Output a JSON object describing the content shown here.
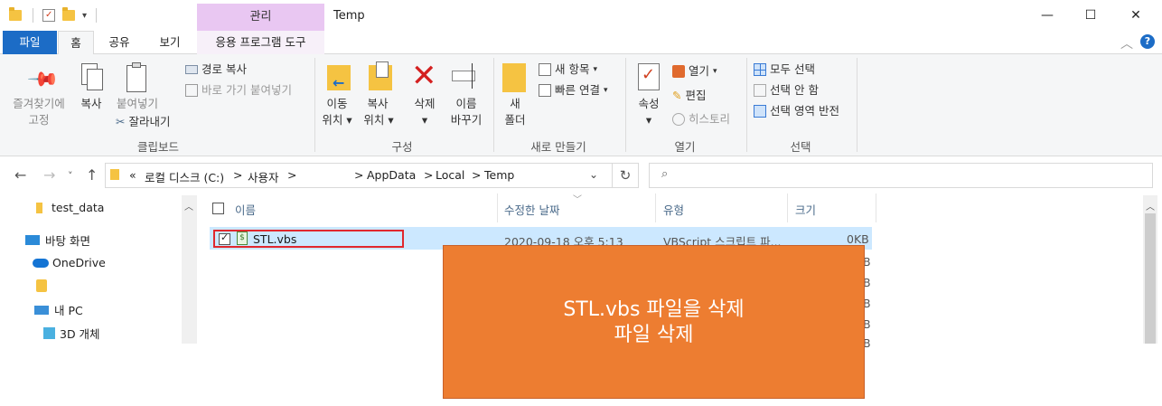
{
  "window": {
    "title": "Temp",
    "context_tab": "관리",
    "controls": {
      "minimize": "—",
      "maximize": "☐",
      "close": "✕"
    }
  },
  "tabs": {
    "file": "파일",
    "home": "홈",
    "share": "공유",
    "view": "보기",
    "app_tools": "응용 프로그램 도구"
  },
  "ribbon": {
    "clipboard": {
      "pin_line1": "즐겨찾기에",
      "pin_line2": "고정",
      "copy": "복사",
      "paste": "붙여넣기",
      "copy_path": "경로 복사",
      "paste_shortcut": "바로 가기 붙여넣기",
      "cut": "잘라내기",
      "label": "클립보드"
    },
    "organize": {
      "move_line1": "이동",
      "move_line2": "위치",
      "copy_line1": "복사",
      "copy_line2": "위치",
      "delete": "삭제",
      "rename_line1": "이름",
      "rename_line2": "바꾸기",
      "label": "구성"
    },
    "new": {
      "folder_line1": "새",
      "folder_line2": "폴더",
      "new_item": "새 항목",
      "easy_access": "빠른 연결",
      "label": "새로 만들기"
    },
    "open": {
      "properties": "속성",
      "open": "열기",
      "edit": "편집",
      "history": "히스토리",
      "label": "열기"
    },
    "select": {
      "select_all": "모두 선택",
      "select_none": "선택 안 함",
      "invert": "선택 영역 반전",
      "label": "선택"
    }
  },
  "address": {
    "prefix": "«",
    "segments": [
      "로컬 디스크 (C:)",
      "사용자",
      "AppData",
      "Local",
      "Temp"
    ],
    "sep": ">"
  },
  "nav": {
    "items": [
      "test_data",
      "바탕 화면",
      "OneDrive",
      "내 PC",
      "3D 개체"
    ]
  },
  "list": {
    "headers": {
      "name": "이름",
      "date": "수정한 날짜",
      "type": "유형",
      "size": "크기"
    },
    "rows": [
      {
        "name": "STL.vbs",
        "date": "2020-09-18 오후 5:13",
        "type": "VBScript 스크립트 파...",
        "size": "0KB"
      }
    ],
    "hidden_size_fragments": [
      "B",
      "B",
      "B",
      "B",
      "B"
    ]
  },
  "overlay": {
    "line1": "STL.vbs 파일을 삭제",
    "line2": "파일 삭제",
    "color": "#ed7d31"
  },
  "colors": {
    "accent": "#1c6cc6",
    "selection": "#cce8ff",
    "highlight": "#e0282e"
  }
}
